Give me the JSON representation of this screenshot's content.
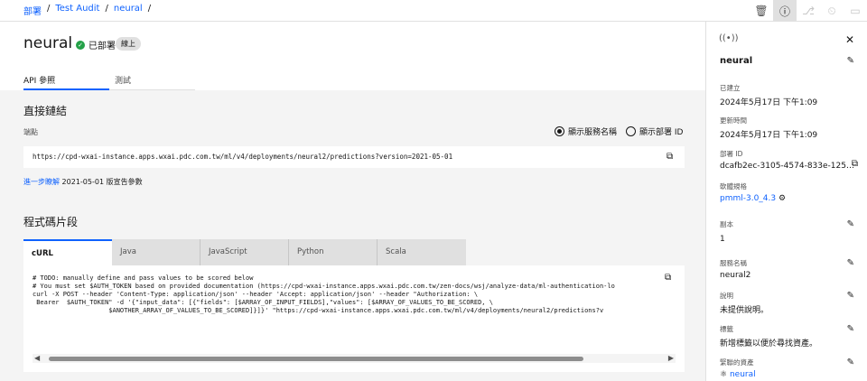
{
  "breadcrumb": [
    "部署",
    "Test Audit",
    "neural"
  ],
  "header": {
    "title": "neural",
    "status": "已部署",
    "tag": "線上",
    "tabs": [
      {
        "label": "API 參照"
      },
      {
        "label": "測試"
      }
    ]
  },
  "direct_link": {
    "heading": "直接鏈結",
    "endpoint_label": "端點",
    "radio_service": "顯示服務名稱",
    "radio_id": "顯示部署 ID",
    "url": "https://cpd-wxai-instance.apps.wxai.pdc.com.tw/ml/v4/deployments/neural2/predictions?version=2021-05-01",
    "note_link": "進一步瞭解",
    "note_text": "2021-05-01 版宣告參數"
  },
  "snippets": {
    "heading": "程式碼片段",
    "tabs": [
      "cURL",
      "Java",
      "JavaScript",
      "Python",
      "Scala"
    ],
    "code": "# TODO: manually define and pass values to be scored below\n# You must set $AUTH_TOKEN based on provided documentation (https://cpd-wxai-instance.apps.wxai.pdc.com.tw/zen-docs/wsj/analyze-data/ml-authentication-lo\ncurl -X POST --header 'Content-Type: application/json' --header 'Accept: application/json' --header \"Authorization: \\\n Bearer  $AUTH_TOKEN\" -d '{\"input_data\": [{\"fields\": [$ARRAY_OF_INPUT_FIELDS],\"values\": [$ARRAY_OF_VALUES_TO_BE_SCORED, \\\n                    $ANOTHER_ARRAY_OF_VALUES_TO_BE_SCORED]}]}' \"https://cpd-wxai-instance.apps.wxai.pdc.com.tw/ml/v4/deployments/neural2/predictions?v"
  },
  "sidebar": {
    "name": "neural",
    "created_label": "已建立",
    "created": "2024年5月17日 下午1:09",
    "updated_label": "更新時間",
    "updated": "2024年5月17日 下午1:09",
    "deploy_id_label": "部署 ID",
    "deploy_id": "dcafb2ec-3105-4574-833e-125…",
    "spec_label": "軟體規格",
    "spec": "pmml-3.0_4.3",
    "copies_label": "副本",
    "copies": "1",
    "service_label": "服務名稱",
    "service": "neural2",
    "desc_label": "說明",
    "desc": "未提供說明。",
    "tags_label": "標籤",
    "tags": "新增標籤以便於尋找資產。",
    "asset_label": "緊聯的資產",
    "asset": "neural"
  },
  "colors": {
    "accent": "#0f62fe",
    "success": "#24a148",
    "panel": "#f4f4f4"
  }
}
